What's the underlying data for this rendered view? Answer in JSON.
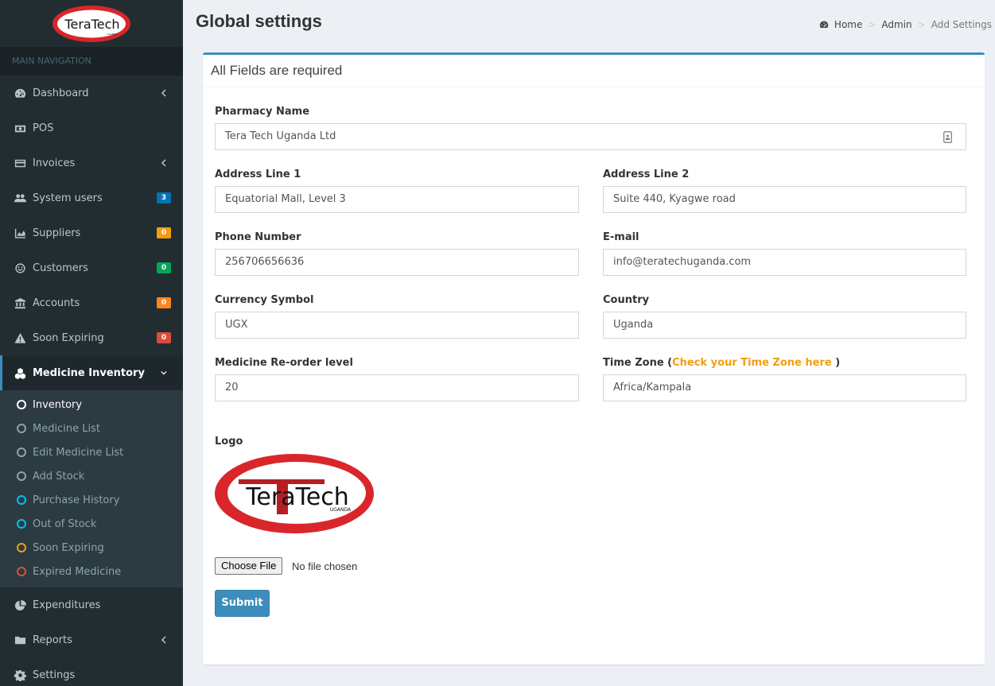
{
  "app": {
    "logo_text": "TeraTech",
    "logo_subtext": "UGANDA"
  },
  "sidebar": {
    "header": "MAIN NAVIGATION",
    "items": [
      {
        "label": "Dashboard",
        "icon": "dashboard-icon"
      },
      {
        "label": "POS",
        "icon": "money-icon"
      },
      {
        "label": "Invoices",
        "icon": "credit-card-icon"
      },
      {
        "label": "System users",
        "icon": "users-icon",
        "badge": "3",
        "badge_color": "#0073b7"
      },
      {
        "label": "Suppliers",
        "icon": "area-chart-icon",
        "badge": "0",
        "badge_color": "#f39c12"
      },
      {
        "label": "Customers",
        "icon": "smile-icon",
        "badge": "0",
        "badge_color": "#00a65a"
      },
      {
        "label": "Accounts",
        "icon": "bank-icon",
        "badge": "0",
        "badge_color": "#ff851b"
      },
      {
        "label": "Soon Expiring",
        "icon": "warning-icon",
        "badge": "0",
        "badge_color": "#dd4b39"
      },
      {
        "label": "Medicine Inventory",
        "icon": "cubes-icon"
      },
      {
        "label": "Expenditures",
        "icon": "pie-chart-icon"
      },
      {
        "label": "Reports",
        "icon": "folder-icon"
      },
      {
        "label": "Settings",
        "icon": "gear-icon"
      }
    ],
    "submenu": [
      {
        "label": "Inventory",
        "color": "#ffffff"
      },
      {
        "label": "Medicine List",
        "color": "#8aa4af"
      },
      {
        "label": "Edit Medicine List",
        "color": "#8aa4af"
      },
      {
        "label": "Add Stock",
        "color": "#8aa4af"
      },
      {
        "label": "Purchase History",
        "color": "#00c0ef"
      },
      {
        "label": "Out of Stock",
        "color": "#00c0ef"
      },
      {
        "label": "Soon Expiring",
        "color": "#f39c12"
      },
      {
        "label": "Expired Medicine",
        "color": "#dd4b39"
      }
    ]
  },
  "header": {
    "title": "Global settings",
    "breadcrumb": [
      "Home",
      "Admin",
      "Add Settings"
    ]
  },
  "form": {
    "box_title": "All Fields are required",
    "pharmacy_name": {
      "label": "Pharmacy Name",
      "value": "Tera Tech Uganda  Ltd"
    },
    "address1": {
      "label": "Address Line 1",
      "value": "Equatorial Mall, Level 3"
    },
    "address2": {
      "label": "Address Line 2",
      "value": "Suite 440,  Kyagwe road"
    },
    "phone": {
      "label": "Phone Number",
      "value": "256706656636"
    },
    "email": {
      "label": "E-mail",
      "value": "info@teratechuganda.com"
    },
    "currency": {
      "label": "Currency Symbol",
      "value": "UGX"
    },
    "country": {
      "label": "Country",
      "value": "Uganda"
    },
    "reorder": {
      "label": "Medicine Re-order level",
      "value": "20"
    },
    "timezone": {
      "label_prefix": "Time Zone (",
      "link": "Check your Time Zone here",
      "label_suffix": " )",
      "value": "Africa/Kampala"
    },
    "logo_label": "Logo",
    "file_button": "Choose File",
    "file_status": "No file chosen",
    "submit": "Submit"
  },
  "colors": {
    "accent": "#3c8dbc",
    "sidebar_bg": "#222d32",
    "link_orange": "#f39c12",
    "logo_red": "#d9262b"
  }
}
